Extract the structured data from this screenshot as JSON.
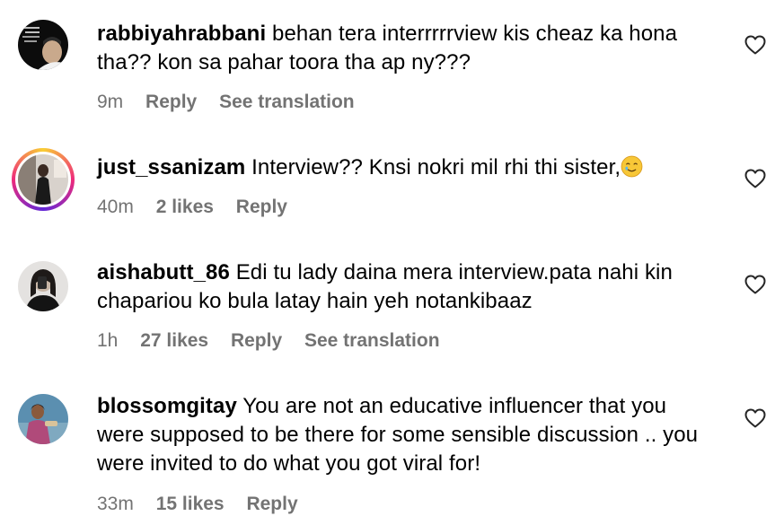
{
  "comments": [
    {
      "username": "rabbiyahrabbani",
      "text": "behan tera interrrrrview kis cheaz ka hona tha?? kon sa pahar toora tha ap ny???",
      "time": "9m",
      "likes": "",
      "reply_label": "Reply",
      "translation_label": "See translation"
    },
    {
      "username": "just_ssanizam",
      "text": "Interview?? Knsi nokri mil rhi thi sister,",
      "time": "40m",
      "likes": "2 likes",
      "reply_label": "Reply",
      "translation_label": ""
    },
    {
      "username": "aishabutt_86",
      "text": "Edi tu lady daina mera interview.pata nahi kin chapariou ko bula latay hain yeh notankibaaz",
      "time": "1h",
      "likes": "27 likes",
      "reply_label": "Reply",
      "translation_label": "See translation"
    },
    {
      "username": "blossomgitay",
      "text": "You are not an educative influencer that you were supposed to be there for some sensible discussion .. you were invited to do what you got viral for!",
      "time": "33m",
      "likes": "15 likes",
      "reply_label": "Reply",
      "translation_label": ""
    }
  ],
  "icons": {
    "like": "heart-outline-icon",
    "emoji": "smiling-face-with-tear-emoji"
  },
  "colors": {
    "meta_text": "#737373",
    "story_ring": "#ee2a7b"
  }
}
